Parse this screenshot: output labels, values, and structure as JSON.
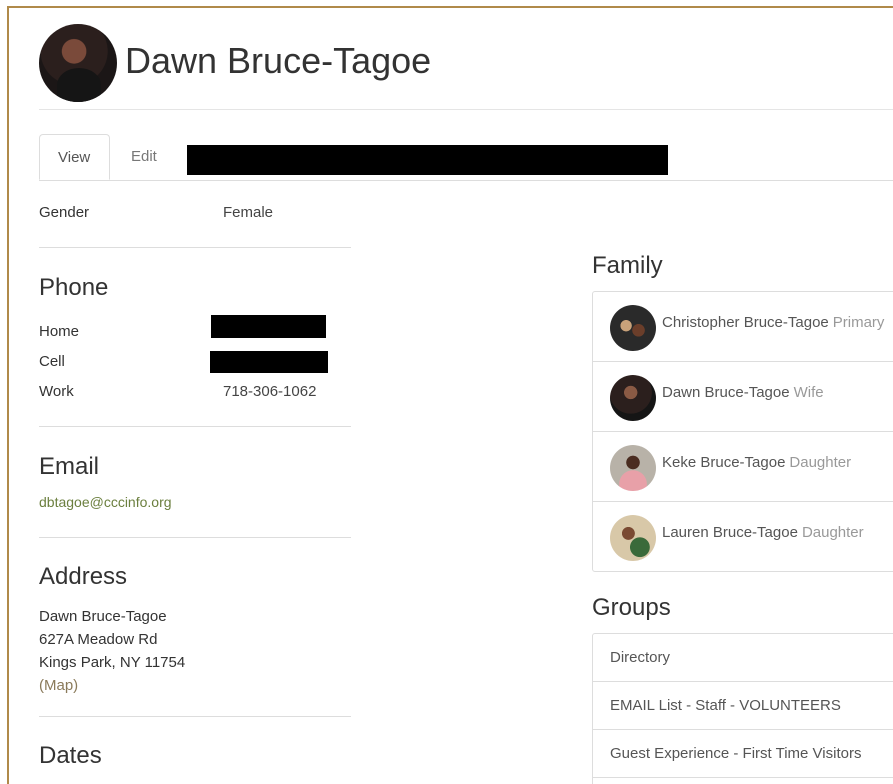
{
  "person": {
    "name": "Dawn Bruce-Tagoe"
  },
  "tabs": [
    {
      "label": "View",
      "active": true
    },
    {
      "label": "Edit",
      "active": false
    }
  ],
  "gender": {
    "label": "Gender",
    "value": "Female"
  },
  "phone": {
    "title": "Phone",
    "rows": [
      {
        "label": "Home",
        "value": ""
      },
      {
        "label": "Cell",
        "value": ""
      },
      {
        "label": "Work",
        "value": "718-306-1062"
      }
    ]
  },
  "email": {
    "title": "Email",
    "address": "dbtagoe@cccinfo.org"
  },
  "address": {
    "title": "Address",
    "line1": "Dawn Bruce-Tagoe",
    "line2": "627A Meadow Rd",
    "line3": "Kings Park, NY 11754",
    "map_link": "(Map)"
  },
  "dates": {
    "title": "Dates"
  },
  "family": {
    "title": "Family",
    "members": [
      {
        "name": "Christopher Bruce-Tagoe",
        "relation": "Primary"
      },
      {
        "name": "Dawn Bruce-Tagoe",
        "relation": "Wife"
      },
      {
        "name": "Keke Bruce-Tagoe",
        "relation": "Daughter"
      },
      {
        "name": "Lauren Bruce-Tagoe",
        "relation": "Daughter"
      }
    ]
  },
  "groups": {
    "title": "Groups",
    "items": [
      "Directory",
      "EMAIL List - Staff - VOLUNTEERS",
      "Guest Experience - First Time Visitors"
    ]
  },
  "colors": {
    "frame_border": "#b08a4a",
    "link": "#6b7f3e",
    "redaction": "#000000"
  }
}
